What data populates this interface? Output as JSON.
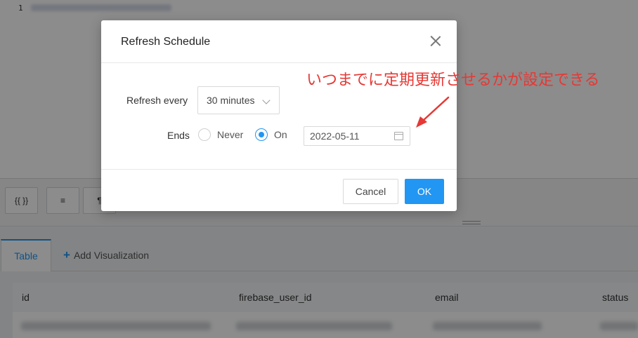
{
  "editor": {
    "line_number": "1"
  },
  "toolbar": {
    "buttons": [
      "{{ }}",
      "≡",
      "¶"
    ]
  },
  "results": {
    "tabs": [
      {
        "label": "Table"
      }
    ],
    "add_visualization_label": "Add Visualization",
    "columns": [
      "id",
      "firebase_user_id",
      "email",
      "status"
    ]
  },
  "modal": {
    "title": "Refresh Schedule",
    "refresh_label": "Refresh every",
    "refresh_value": "30 minutes",
    "ends_label": "Ends",
    "never_label": "Never",
    "on_label": "On",
    "selected_end": "On",
    "end_date": "2022-05-11",
    "cancel_label": "Cancel",
    "ok_label": "OK"
  },
  "annotation": {
    "text": "いつまでに定期更新させるかが設定できる",
    "color": "#e53935"
  },
  "colors": {
    "accent": "#2196f3"
  }
}
